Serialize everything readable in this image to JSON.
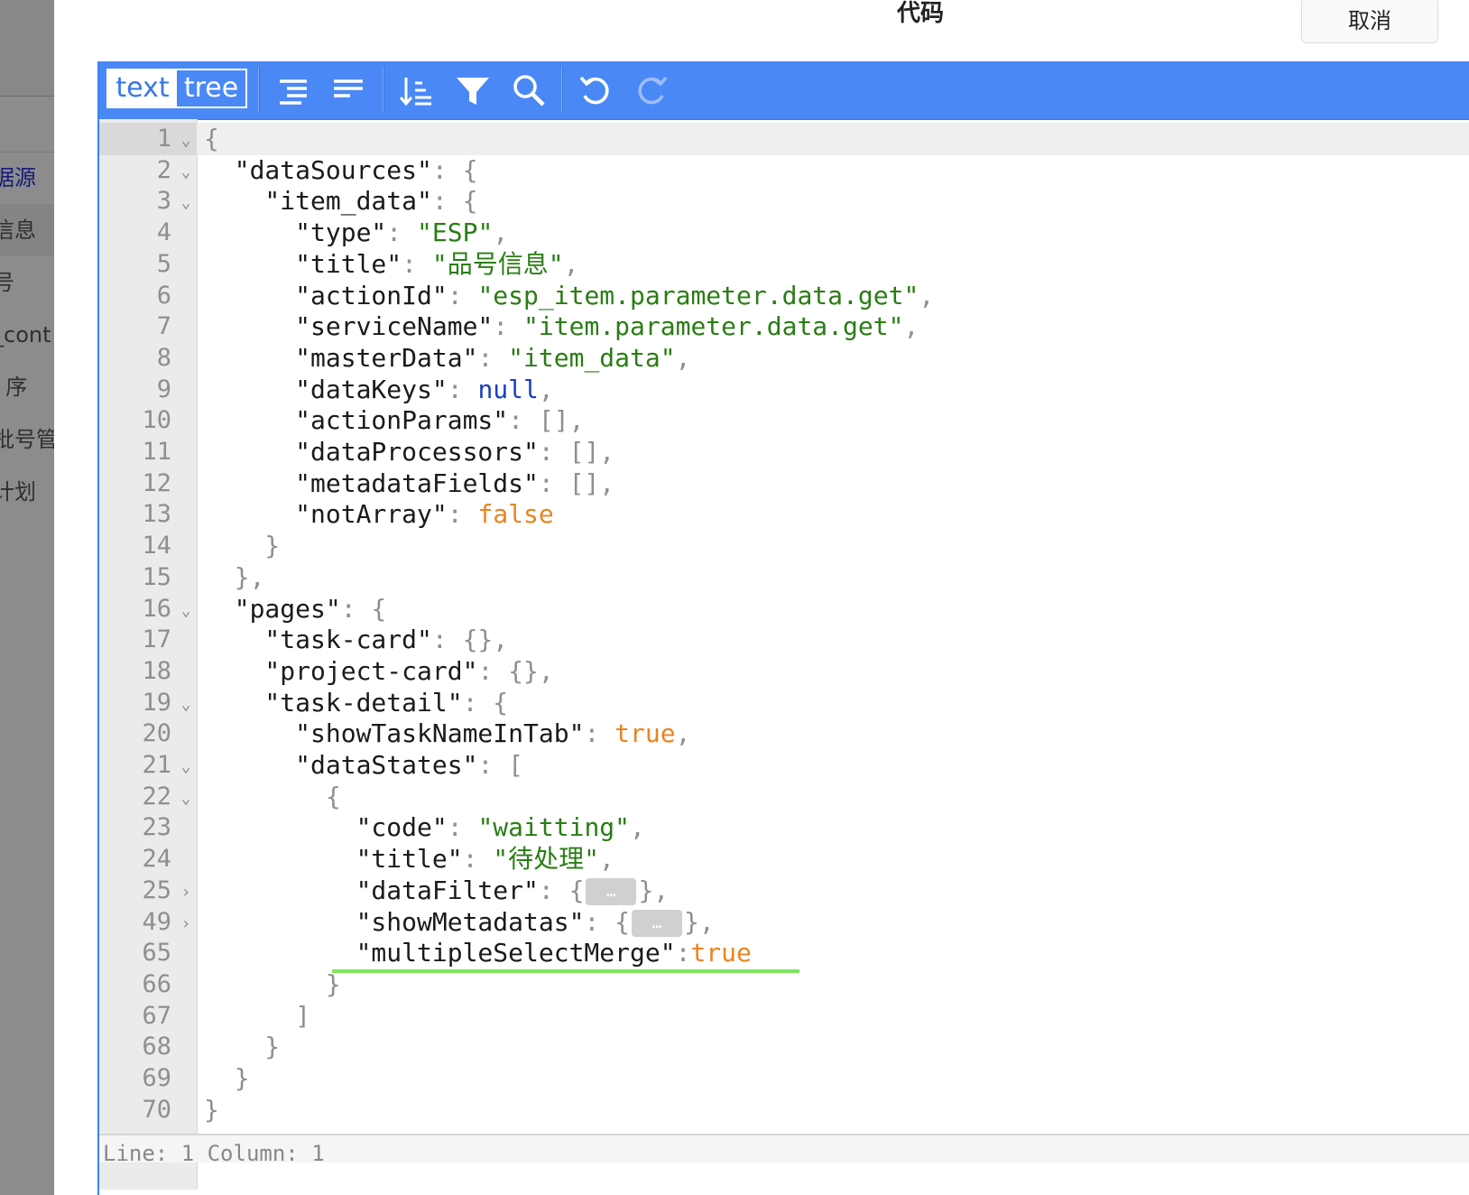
{
  "background_menu": {
    "items": [
      {
        "label": "据源",
        "active": true
      },
      {
        "label": "信息",
        "selected": true
      },
      {
        "label": "号"
      },
      {
        "label": "_cont"
      },
      {
        "label": "l  序"
      },
      {
        "label": "批号管"
      },
      {
        "label": " 计划"
      }
    ]
  },
  "modal": {
    "title": "代码",
    "cancel_label": "取消"
  },
  "toolbar": {
    "modes": {
      "text": "text",
      "tree": "tree"
    },
    "icons": [
      "format-icon",
      "compact-icon",
      "sort-icon",
      "filter-icon",
      "search-icon",
      "undo-icon",
      "redo-icon"
    ]
  },
  "colors": {
    "toolbar": "#4a88f5",
    "string": "#2a7d14",
    "null": "#1a3ec4",
    "boolean": "#ea8420",
    "punctuation": "#8f8f8f",
    "underline": "#7ce65c"
  },
  "editor": {
    "lines": [
      {
        "n": "1",
        "fold": "open",
        "tokens": [
          [
            "p",
            "{"
          ]
        ]
      },
      {
        "n": "2",
        "fold": "open",
        "tokens": [
          [
            "k",
            "  \"dataSources\""
          ],
          [
            "p",
            ": {"
          ]
        ]
      },
      {
        "n": "3",
        "fold": "open",
        "tokens": [
          [
            "k",
            "    \"item_data\""
          ],
          [
            "p",
            ": {"
          ]
        ]
      },
      {
        "n": "4",
        "tokens": [
          [
            "k",
            "      \"type\""
          ],
          [
            "p",
            ": "
          ],
          [
            "s",
            "\"ESP\""
          ],
          [
            "p",
            ","
          ]
        ]
      },
      {
        "n": "5",
        "tokens": [
          [
            "k",
            "      \"title\""
          ],
          [
            "p",
            ": "
          ],
          [
            "s",
            "\"品号信息\""
          ],
          [
            "p",
            ","
          ]
        ]
      },
      {
        "n": "6",
        "tokens": [
          [
            "k",
            "      \"actionId\""
          ],
          [
            "p",
            ": "
          ],
          [
            "s",
            "\"esp_item.parameter.data.get\""
          ],
          [
            "p",
            ","
          ]
        ]
      },
      {
        "n": "7",
        "tokens": [
          [
            "k",
            "      \"serviceName\""
          ],
          [
            "p",
            ": "
          ],
          [
            "s",
            "\"item.parameter.data.get\""
          ],
          [
            "p",
            ","
          ]
        ]
      },
      {
        "n": "8",
        "tokens": [
          [
            "k",
            "      \"masterData\""
          ],
          [
            "p",
            ": "
          ],
          [
            "s",
            "\"item_data\""
          ],
          [
            "p",
            ","
          ]
        ]
      },
      {
        "n": "9",
        "tokens": [
          [
            "k",
            "      \"dataKeys\""
          ],
          [
            "p",
            ": "
          ],
          [
            "n",
            "null"
          ],
          [
            "p",
            ","
          ]
        ]
      },
      {
        "n": "10",
        "tokens": [
          [
            "k",
            "      \"actionParams\""
          ],
          [
            "p",
            ": [],"
          ]
        ]
      },
      {
        "n": "11",
        "tokens": [
          [
            "k",
            "      \"dataProcessors\""
          ],
          [
            "p",
            ": [],"
          ]
        ]
      },
      {
        "n": "12",
        "tokens": [
          [
            "k",
            "      \"metadataFields\""
          ],
          [
            "p",
            ": [],"
          ]
        ]
      },
      {
        "n": "13",
        "tokens": [
          [
            "k",
            "      \"notArray\""
          ],
          [
            "p",
            ": "
          ],
          [
            "b",
            "false"
          ]
        ]
      },
      {
        "n": "14",
        "tokens": [
          [
            "p",
            "    }"
          ]
        ]
      },
      {
        "n": "15",
        "tokens": [
          [
            "p",
            "  },"
          ]
        ]
      },
      {
        "n": "16",
        "fold": "open",
        "tokens": [
          [
            "k",
            "  \"pages\""
          ],
          [
            "p",
            ": {"
          ]
        ]
      },
      {
        "n": "17",
        "tokens": [
          [
            "k",
            "    \"task-card\""
          ],
          [
            "p",
            ": {},"
          ]
        ]
      },
      {
        "n": "18",
        "tokens": [
          [
            "k",
            "    \"project-card\""
          ],
          [
            "p",
            ": {},"
          ]
        ]
      },
      {
        "n": "19",
        "fold": "open",
        "tokens": [
          [
            "k",
            "    \"task-detail\""
          ],
          [
            "p",
            ": {"
          ]
        ]
      },
      {
        "n": "20",
        "tokens": [
          [
            "k",
            "      \"showTaskNameInTab\""
          ],
          [
            "p",
            ": "
          ],
          [
            "b",
            "true"
          ],
          [
            "p",
            ","
          ]
        ]
      },
      {
        "n": "21",
        "fold": "open",
        "tokens": [
          [
            "k",
            "      \"dataStates\""
          ],
          [
            "p",
            ": ["
          ]
        ]
      },
      {
        "n": "22",
        "fold": "open",
        "tokens": [
          [
            "p",
            "        {"
          ]
        ]
      },
      {
        "n": "23",
        "tokens": [
          [
            "k",
            "          \"code\""
          ],
          [
            "p",
            ": "
          ],
          [
            "s",
            "\"waitting\""
          ],
          [
            "p",
            ","
          ]
        ]
      },
      {
        "n": "24",
        "tokens": [
          [
            "k",
            "          \"title\""
          ],
          [
            "p",
            ": "
          ],
          [
            "s",
            "\"待处理\""
          ],
          [
            "p",
            ","
          ]
        ]
      },
      {
        "n": "25",
        "fold": "closed",
        "tokens": [
          [
            "k",
            "          \"dataFilter\""
          ],
          [
            "p",
            ": {"
          ],
          [
            "pill",
            "…"
          ],
          [
            "p",
            "},"
          ]
        ]
      },
      {
        "n": "49",
        "fold": "closed",
        "tokens": [
          [
            "k",
            "          \"showMetadatas\""
          ],
          [
            "p",
            ": {"
          ],
          [
            "pill",
            "…"
          ],
          [
            "p",
            "},"
          ]
        ]
      },
      {
        "n": "65",
        "tokens": [
          [
            "k",
            "          \"multipleSelectMerge\""
          ],
          [
            "p",
            ":"
          ],
          [
            "b",
            "true"
          ]
        ]
      },
      {
        "n": "66",
        "tokens": [
          [
            "p",
            "        }"
          ]
        ]
      },
      {
        "n": "67",
        "tokens": [
          [
            "p",
            "      ]"
          ]
        ]
      },
      {
        "n": "68",
        "tokens": [
          [
            "p",
            "    }"
          ]
        ]
      },
      {
        "n": "69",
        "tokens": [
          [
            "p",
            "  }"
          ]
        ]
      },
      {
        "n": "70",
        "tokens": [
          [
            "p",
            "}"
          ]
        ]
      }
    ],
    "status": "Line: 1  Column: 1"
  }
}
